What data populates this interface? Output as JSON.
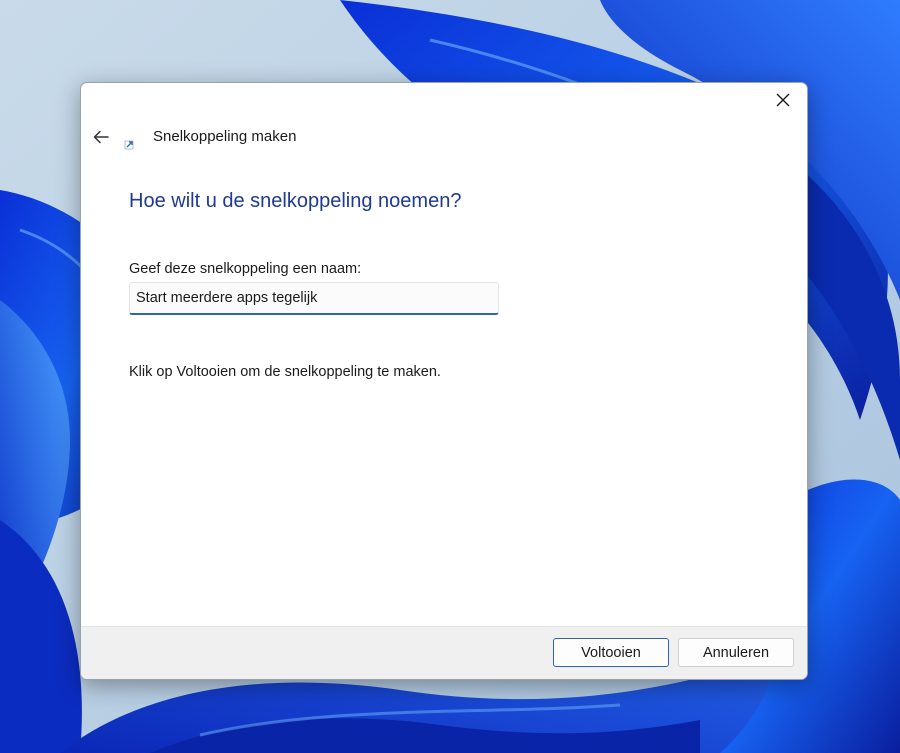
{
  "wizard": {
    "title": "Snelkoppeling maken",
    "heading": "Hoe wilt u de snelkoppeling noemen?",
    "name_label": "Geef deze snelkoppeling een naam:",
    "name_value": "Start meerdere apps tegelijk",
    "hint": "Klik op Voltooien om de snelkoppeling te maken.",
    "icons": {
      "back": "arrow-left-icon",
      "close": "close-icon",
      "shortcut": "shortcut-arrow-icon"
    }
  },
  "footer": {
    "finish_label": "Voltooien",
    "cancel_label": "Annuleren"
  },
  "theme": {
    "accent": "#2d63b8",
    "heading_color": "#1f3a93",
    "footer_bg": "#f0f0f0"
  }
}
